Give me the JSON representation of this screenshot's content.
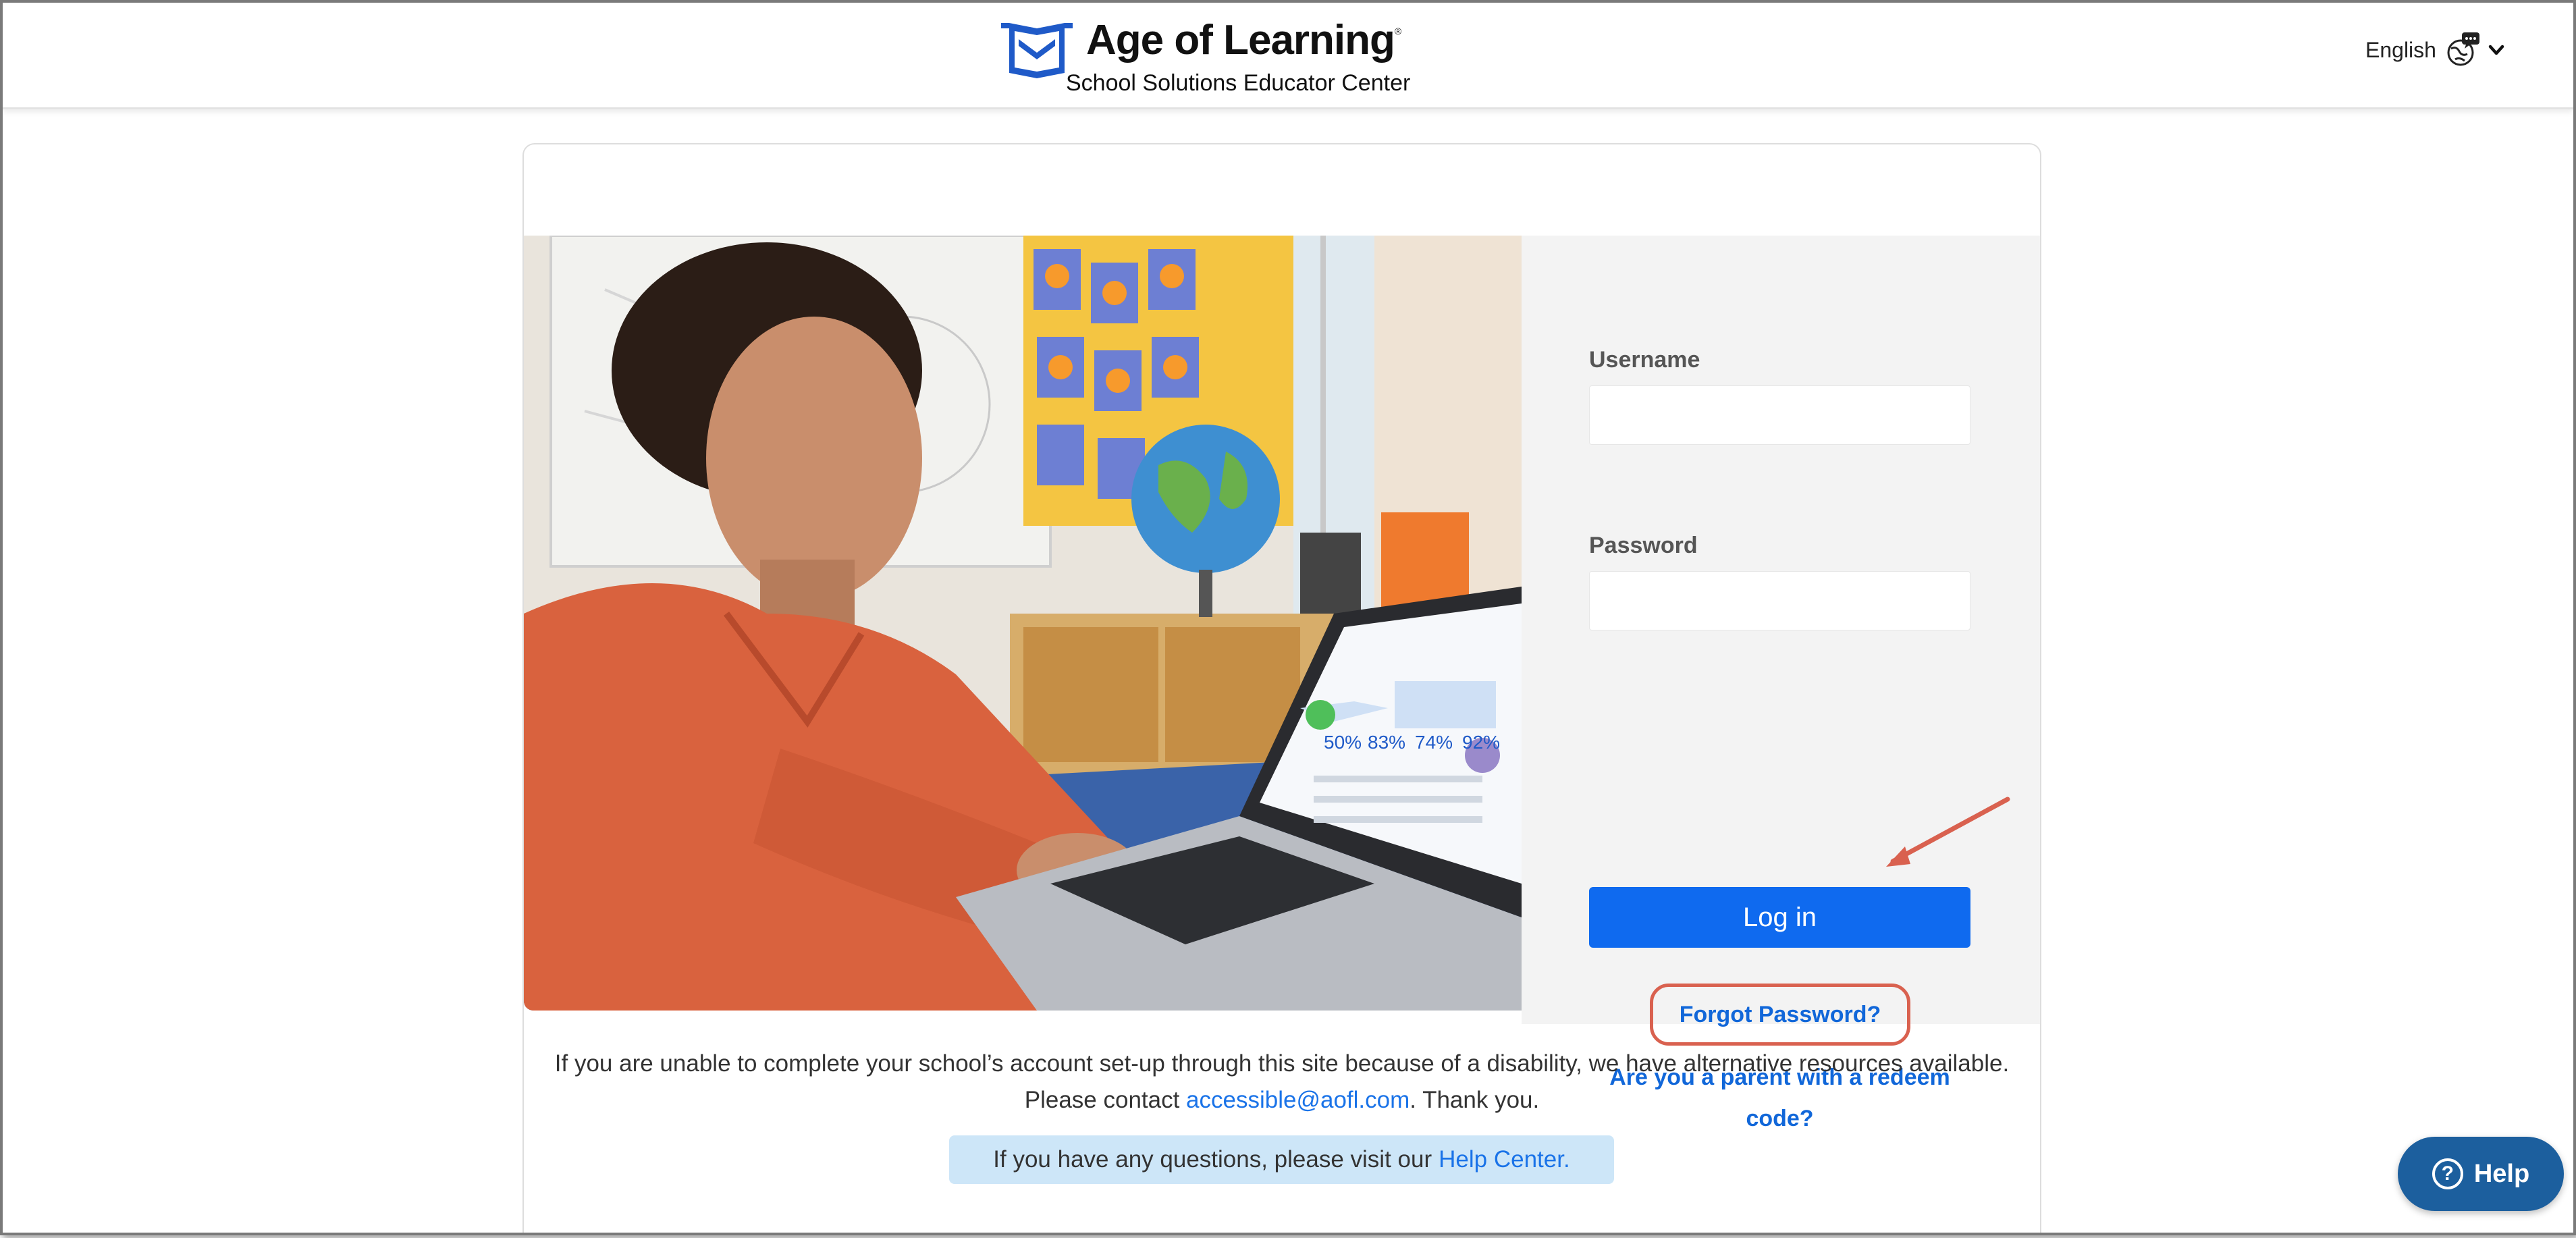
{
  "header": {
    "brand_name": "Age of Learning",
    "brand_mark": "®",
    "subtitle": "School Solutions Educator Center",
    "language": {
      "selected": "English",
      "icon": "globe-speech-icon",
      "caret_icon": "chevron-down-icon"
    }
  },
  "hero_image": {
    "description_icon": "teacher-at-laptop-photo"
  },
  "login": {
    "username_label": "Username",
    "username_value": "",
    "password_label": "Password",
    "password_value": "",
    "login_button": "Log in",
    "forgot_password": "Forgot Password?",
    "parent_redeem_line1": "Are you a parent with a redeem",
    "parent_redeem_line2": "code?"
  },
  "accessibility": {
    "line1": "If you are unable to complete your school’s account set-up through this site because of a disability, we have alternative resources available.",
    "line2_prefix": "Please contact ",
    "email": "accessible@aofl.com",
    "line2_suffix": ". Thank you."
  },
  "help_banner": {
    "text": "If you have any questions, please visit our",
    "link": "Help Center."
  },
  "help_widget": {
    "label": "Help",
    "icon": "question-circle-icon"
  },
  "colors": {
    "primary": "#0f6aef",
    "link": "#1167d9",
    "annotation": "#d9614f",
    "help_widget": "#1c5f9e",
    "banner": "#cde6f8",
    "panel": "#f3f3f3"
  }
}
